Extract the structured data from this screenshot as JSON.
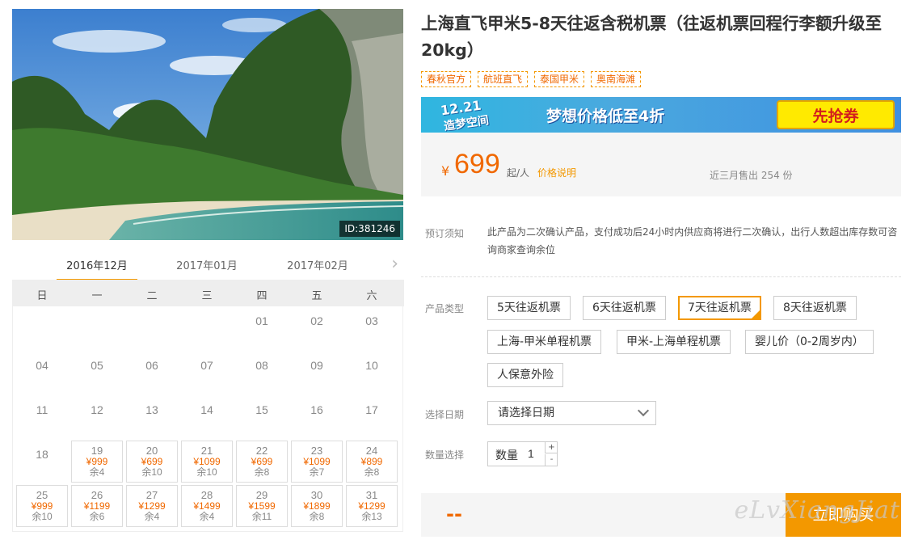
{
  "photo": {
    "id_label": "ID:381246"
  },
  "calendar": {
    "months": [
      "2016年12月",
      "2017年01月",
      "2017年02月"
    ],
    "next_icon": "chevron-right-icon",
    "weekdays": [
      "日",
      "一",
      "二",
      "三",
      "四",
      "五",
      "六"
    ],
    "plain_days": [
      "01",
      "02",
      "03",
      "04",
      "05",
      "06",
      "07",
      "08",
      "09",
      "10",
      "11",
      "12",
      "13",
      "14",
      "15",
      "16",
      "17",
      "18"
    ],
    "priced_days": [
      {
        "day": "19",
        "price": "¥999",
        "remain": "余4"
      },
      {
        "day": "20",
        "price": "¥699",
        "remain": "余10"
      },
      {
        "day": "21",
        "price": "¥1099",
        "remain": "余10"
      },
      {
        "day": "22",
        "price": "¥699",
        "remain": "余8"
      },
      {
        "day": "23",
        "price": "¥1099",
        "remain": "余7"
      },
      {
        "day": "24",
        "price": "¥899",
        "remain": "余8"
      },
      {
        "day": "25",
        "price": "¥999",
        "remain": "余10"
      },
      {
        "day": "26",
        "price": "¥1199",
        "remain": "余6"
      },
      {
        "day": "27",
        "price": "¥1299",
        "remain": "余4"
      },
      {
        "day": "28",
        "price": "¥1499",
        "remain": "余4"
      },
      {
        "day": "29",
        "price": "¥1599",
        "remain": "余11"
      },
      {
        "day": "30",
        "price": "¥1899",
        "remain": "余8"
      },
      {
        "day": "31",
        "price": "¥1299",
        "remain": "余13"
      }
    ]
  },
  "product": {
    "title": "上海直飞甲米5-8天往返含税机票（往返机票回程行李额升级至20kg）",
    "tags": [
      "春秋官方",
      "航班直飞",
      "泰国甲米",
      "奥南海滩"
    ]
  },
  "banner": {
    "logo_line1": "12.21",
    "logo_line2": "造梦空间",
    "slogan": "梦想价格低至4折",
    "button": "先抢券"
  },
  "price": {
    "currency": "¥",
    "amount": "699",
    "unit": "起/人",
    "note_link": "价格说明",
    "sold": "近三月售出 254 份"
  },
  "notice": {
    "label": "预订须知",
    "text": "此产品为二次确认产品，支付成功后24小时内供应商将进行二次确认，出行人数超出库存数可咨询商家查询余位"
  },
  "options": {
    "label": "产品类型",
    "items": [
      "5天往返机票",
      "6天往返机票",
      "7天往返机票",
      "8天往返机票",
      "上海-甲米单程机票",
      "甲米-上海单程机票",
      "婴儿价（0-2周岁内）",
      "人保意外险"
    ],
    "selected": "7天往返机票"
  },
  "date": {
    "label": "选择日期",
    "placeholder": "请选择日期"
  },
  "quantity": {
    "label": "数量选择",
    "inner_label": "数量",
    "value": "1",
    "up": "+",
    "down": "-"
  },
  "buy": {
    "total": "--",
    "button": "立即购买"
  },
  "watermark": "eLvXiangJiat"
}
